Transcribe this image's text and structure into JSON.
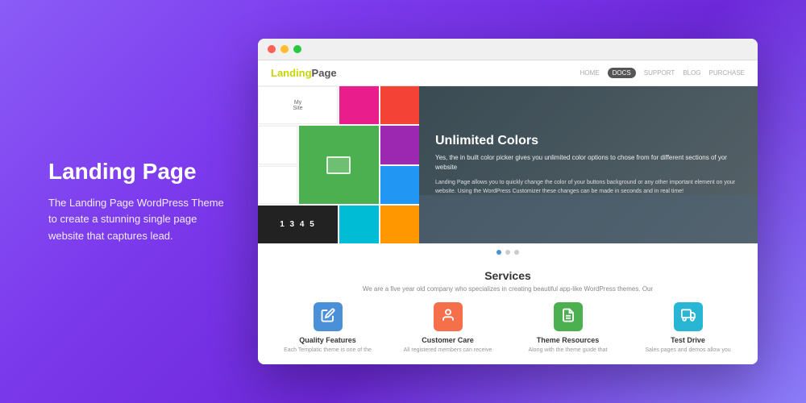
{
  "background": {
    "gradient_start": "#8b5cf6",
    "gradient_end": "#7c3aed"
  },
  "text_section": {
    "title": "Landing Page",
    "description": "The Landing Page WordPress Theme to create a stunning single page website that captures lead."
  },
  "browser": {
    "dots": [
      "red",
      "yellow",
      "green"
    ]
  },
  "theme_preview": {
    "nav": {
      "logo_yellow": "Landing",
      "logo_gray": "Page",
      "links": [
        "HOME",
        "DOCS",
        "SUPPORT",
        "BLOG",
        "PURCHASE"
      ],
      "active_link": "DOCS"
    },
    "hero": {
      "title": "Unlimited Colors",
      "subtitle": "Yes, the in built color picker gives you unlimited color options to chose from for different sections of yor website",
      "body": "Landing Page allows you to quickly change the color of your buttons background or any other important element on your website. Using the WordPress Customizer these changes can be made in seconds and in real time!",
      "counter": "1 3 4 5"
    },
    "dots_indicator": [
      "active",
      "inactive",
      "inactive"
    ],
    "services": {
      "title": "Services",
      "description": "We are a five year old company who specializes in creating beautiful app-like WordPress themes. Our",
      "items": [
        {
          "name": "Quality Features",
          "icon": "✏",
          "icon_type": "blue",
          "text": "Each Templatic theme is one of the"
        },
        {
          "name": "Customer Care",
          "icon": "👤",
          "icon_type": "orange",
          "text": "All registered members can receive"
        },
        {
          "name": "Theme Resources",
          "icon": "📄",
          "icon_type": "green",
          "text": "Along with the theme guide that"
        },
        {
          "name": "Test Drive",
          "icon": "🚗",
          "icon_type": "cyan",
          "text": "Sales pages and demos allow you"
        }
      ]
    }
  }
}
